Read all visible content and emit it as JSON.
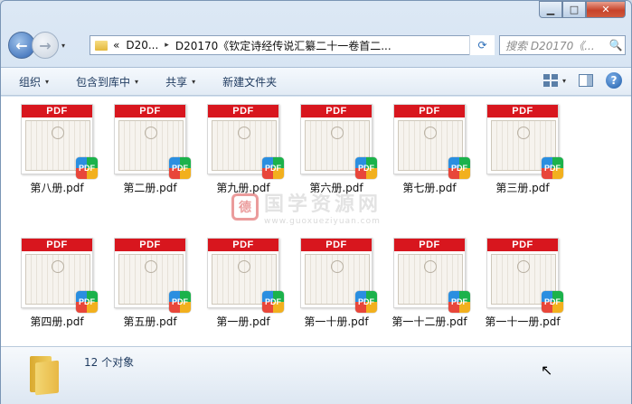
{
  "window": {
    "minimize_label": "▁",
    "maximize_label": "□",
    "close_label": "✕"
  },
  "nav": {
    "back_icon": "←",
    "forward_icon": "→",
    "history_dropdown": "▾"
  },
  "address": {
    "prefix": "«",
    "segment1": "D20...",
    "separator": "▸",
    "segment2": "D20170《钦定诗经传说汇纂二十一卷首二...",
    "dropdown": "▾",
    "refresh_icon": "⟳"
  },
  "search": {
    "placeholder": "搜索 D20170《...",
    "icon": "🔍"
  },
  "toolbar": {
    "organize": "组织",
    "include_in_library": "包含到库中",
    "share": "共享",
    "new_folder": "新建文件夹",
    "dropdown": "▾",
    "help": "?"
  },
  "files": [
    {
      "name": "第八册.pdf"
    },
    {
      "name": "第二册.pdf"
    },
    {
      "name": "第九册.pdf"
    },
    {
      "name": "第六册.pdf"
    },
    {
      "name": "第七册.pdf"
    },
    {
      "name": "第三册.pdf"
    },
    {
      "name": "第四册.pdf"
    },
    {
      "name": "第五册.pdf"
    },
    {
      "name": "第一册.pdf"
    },
    {
      "name": "第一十册.pdf"
    },
    {
      "name": "第一十二册.pdf"
    },
    {
      "name": "第一十一册.pdf"
    }
  ],
  "file_icon": {
    "band_label": "PDF",
    "badge_label": "PDF"
  },
  "status": {
    "count": "12 个对象"
  },
  "watermark": {
    "logo": "德",
    "title": "国学资源网",
    "url": "www.guoxueziyuan.com"
  },
  "colors": {
    "pdf_red": "#d8161e",
    "close_red": "#c7432a",
    "toolbar_text": "#1e3a5f"
  }
}
